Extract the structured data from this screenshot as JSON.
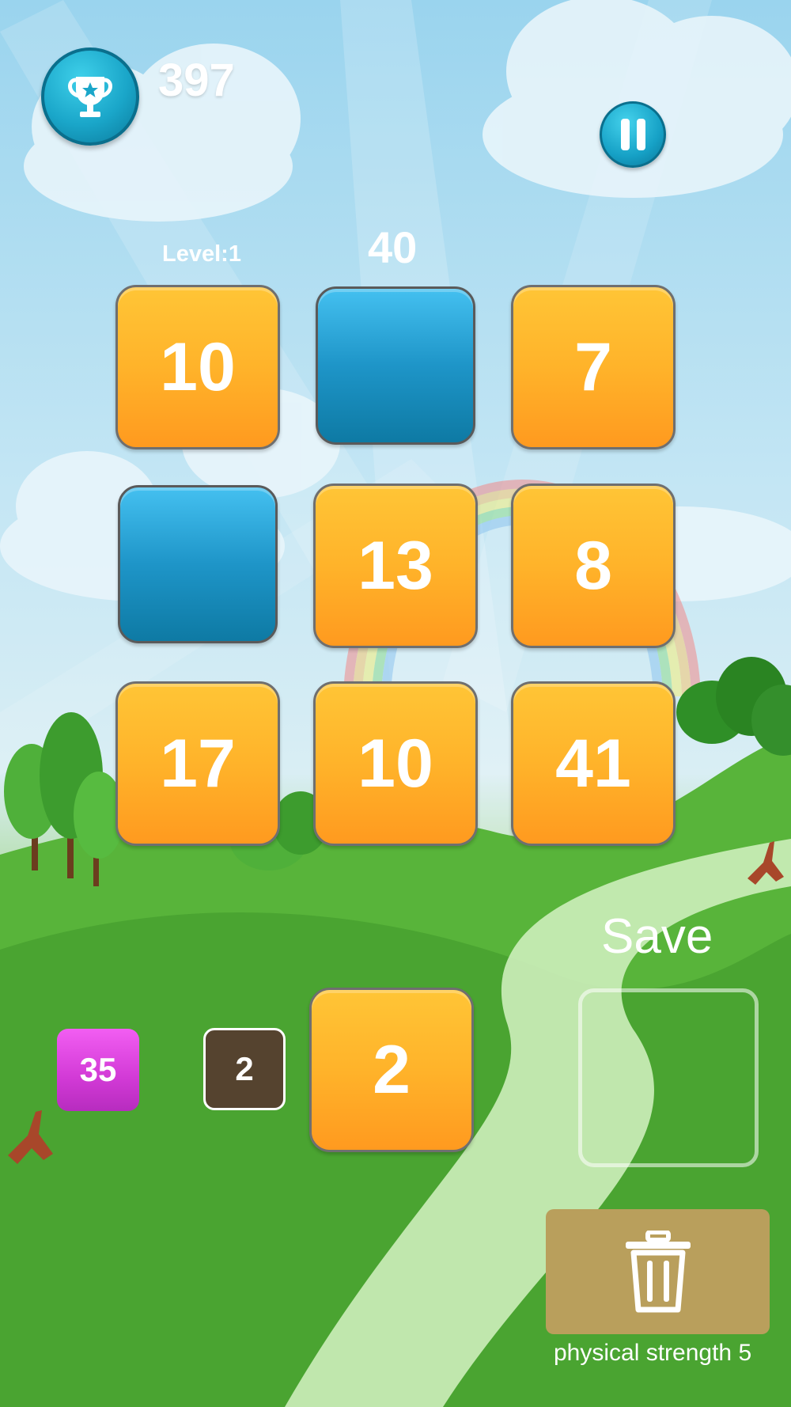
{
  "header": {
    "score": "397",
    "level_label": "Level:1",
    "target": "40"
  },
  "board": {
    "tiles": [
      {
        "value": "10",
        "color": "orange"
      },
      {
        "value": "",
        "color": "blue"
      },
      {
        "value": "7",
        "color": "orange"
      },
      {
        "value": "",
        "color": "blue"
      },
      {
        "value": "13",
        "color": "orange"
      },
      {
        "value": "8",
        "color": "orange"
      },
      {
        "value": "17",
        "color": "orange"
      },
      {
        "value": "10",
        "color": "orange"
      },
      {
        "value": "41",
        "color": "orange"
      }
    ]
  },
  "queue": {
    "next_a": "35",
    "next_b": "2",
    "current": "2"
  },
  "side": {
    "save_label": "Save",
    "strength_label": "physical strength 5"
  },
  "colors": {
    "tile_orange": "#ffb32a",
    "tile_blue": "#1e95c8",
    "mini_magenta": "#d23ad6",
    "mini_brown": "#55432f",
    "trash_bg": "#b99f5c",
    "button_teal": "#16a1c6"
  },
  "icons": {
    "trophy": "trophy-icon",
    "pause": "pause-icon",
    "trash": "trash-icon"
  }
}
